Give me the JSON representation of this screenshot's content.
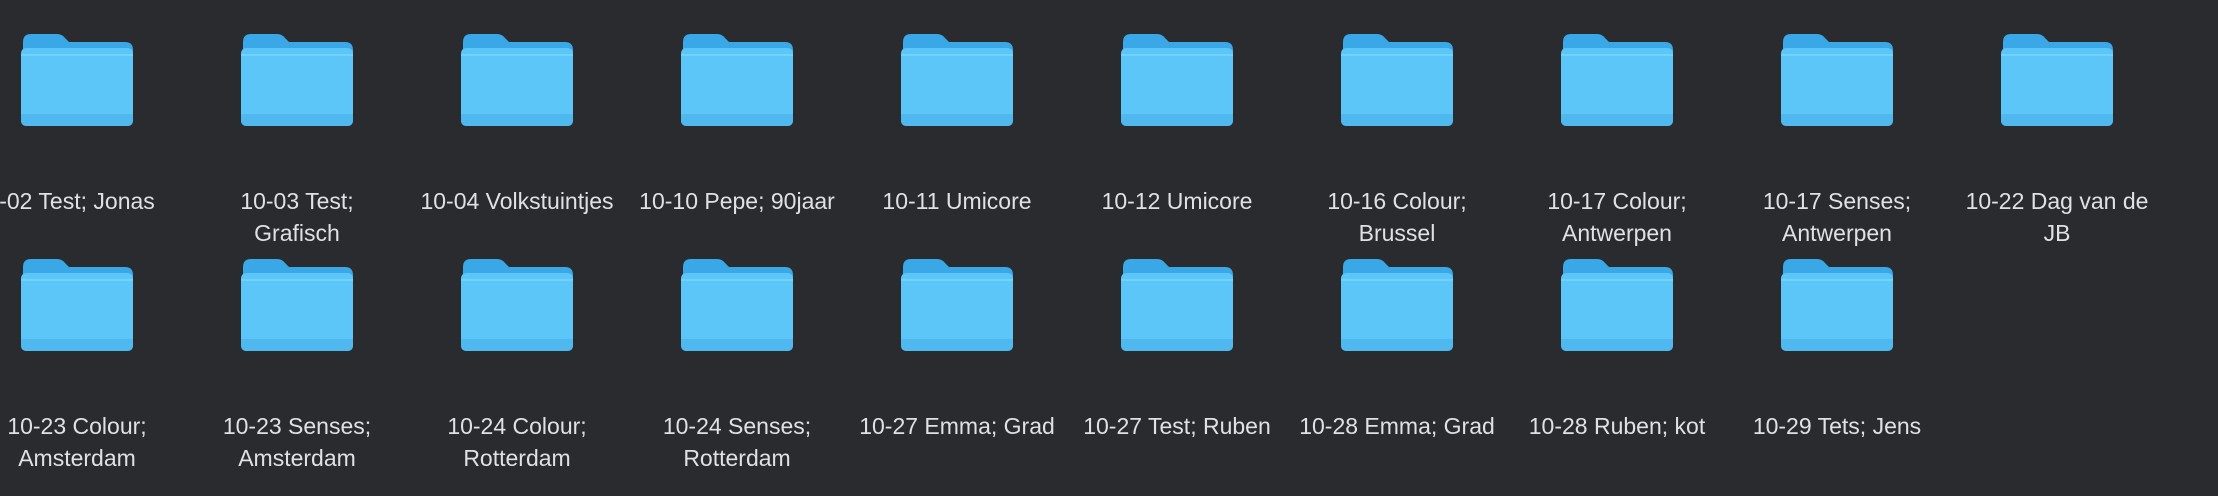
{
  "folders": [
    {
      "label": "-02 Test; Jonas",
      "label_text": "-02 Test; Jonas"
    },
    {
      "label": "10-03 Test; Grafisch"
    },
    {
      "label": "10-04 Volkstuintjes"
    },
    {
      "label": "10-10 Pepe; 90jaar"
    },
    {
      "label": "10-11 Umicore"
    },
    {
      "label": "10-12 Umicore"
    },
    {
      "label": "10-16 Colour; Brussel"
    },
    {
      "label": "10-17 Colour; Antwerpen"
    },
    {
      "label": "10-17 Senses; Antwerpen"
    },
    {
      "label": "10-22 Dag van de JB"
    },
    {
      "label": "10-23 Colour; Amsterdam"
    },
    {
      "label": "10-23 Senses; Amsterdam"
    },
    {
      "label": "10-24 Colour; Rotterdam"
    },
    {
      "label": "10-24 Senses; Rotterdam"
    },
    {
      "label": "10-27 Emma; Grad"
    },
    {
      "label": "10-27 Test; Ruben"
    },
    {
      "label": "10-28 Emma; Grad"
    },
    {
      "label": "10-28 Ruben; kot"
    },
    {
      "label": "10-29 Tets; Jens"
    }
  ],
  "colors": {
    "background": "#292b2e",
    "folder_back": "#3aa7e6",
    "folder_front": "#5cc6f9",
    "label_text": "#dfe1e4"
  },
  "icon": "folder-icon"
}
